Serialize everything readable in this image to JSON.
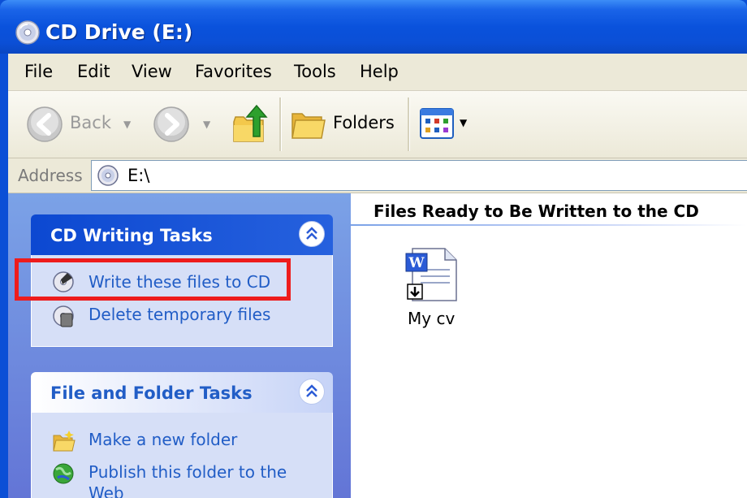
{
  "window": {
    "title": "CD Drive (E:)"
  },
  "menu": {
    "items": [
      "File",
      "Edit",
      "View",
      "Favorites",
      "Tools",
      "Help"
    ]
  },
  "toolbar": {
    "back_label": "Back",
    "folders_label": "Folders"
  },
  "address": {
    "label": "Address",
    "value": "E:\\"
  },
  "task_pane": {
    "cd_writing": {
      "title": "CD Writing Tasks",
      "items": [
        "Write these files to CD",
        "Delete temporary files"
      ]
    },
    "file_folder": {
      "title": "File and Folder Tasks",
      "items": [
        "Make a new folder",
        "Publish this folder to the Web"
      ]
    }
  },
  "content": {
    "group_header": "Files Ready to Be Written to the CD",
    "files": [
      {
        "name": "My cv",
        "icon": "word-document-icon"
      }
    ]
  },
  "colors": {
    "title_bar": "#0b4fd6",
    "task_link": "#215dc6",
    "highlight": "#ee1c1c",
    "task_pane_bg": "#6375d6"
  }
}
